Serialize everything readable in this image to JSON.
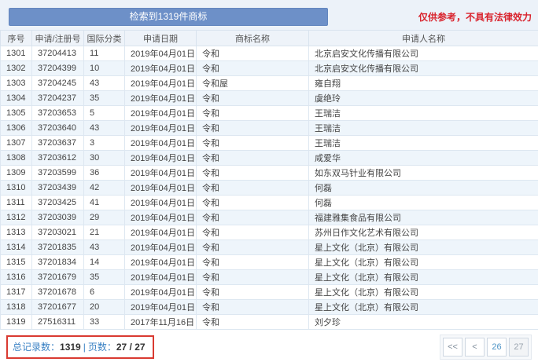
{
  "header": {
    "search_result_button": "检索到1319件商标",
    "disclaimer": "仅供参考，不具有法律效力"
  },
  "table": {
    "columns": [
      "序号",
      "申请/注册号",
      "国际分类",
      "申请日期",
      "商标名称",
      "申请人名称"
    ],
    "rows": [
      {
        "no": "1301",
        "reg_no": "37204413",
        "intl_class": "11",
        "date": "2019年04月01日",
        "mark": "令和",
        "applicant": "北京启安文化传播有限公司"
      },
      {
        "no": "1302",
        "reg_no": "37204399",
        "intl_class": "10",
        "date": "2019年04月01日",
        "mark": "令和",
        "applicant": "北京启安文化传播有限公司"
      },
      {
        "no": "1303",
        "reg_no": "37204245",
        "intl_class": "43",
        "date": "2019年04月01日",
        "mark": "令和屋",
        "applicant": "雍自翔"
      },
      {
        "no": "1304",
        "reg_no": "37204237",
        "intl_class": "35",
        "date": "2019年04月01日",
        "mark": "令和",
        "applicant": "虞绝玲"
      },
      {
        "no": "1305",
        "reg_no": "37203653",
        "intl_class": "5",
        "date": "2019年04月01日",
        "mark": "令和",
        "applicant": "王瑞洁"
      },
      {
        "no": "1306",
        "reg_no": "37203640",
        "intl_class": "43",
        "date": "2019年04月01日",
        "mark": "令和",
        "applicant": "王瑞洁"
      },
      {
        "no": "1307",
        "reg_no": "37203637",
        "intl_class": "3",
        "date": "2019年04月01日",
        "mark": "令和",
        "applicant": "王瑞洁"
      },
      {
        "no": "1308",
        "reg_no": "37203612",
        "intl_class": "30",
        "date": "2019年04月01日",
        "mark": "令和",
        "applicant": "咸爱华"
      },
      {
        "no": "1309",
        "reg_no": "37203599",
        "intl_class": "36",
        "date": "2019年04月01日",
        "mark": "令和",
        "applicant": "如东双马针业有限公司"
      },
      {
        "no": "1310",
        "reg_no": "37203439",
        "intl_class": "42",
        "date": "2019年04月01日",
        "mark": "令和",
        "applicant": "何磊"
      },
      {
        "no": "1311",
        "reg_no": "37203425",
        "intl_class": "41",
        "date": "2019年04月01日",
        "mark": "令和",
        "applicant": "何磊"
      },
      {
        "no": "1312",
        "reg_no": "37203039",
        "intl_class": "29",
        "date": "2019年04月01日",
        "mark": "令和",
        "applicant": "福建雅集食品有限公司"
      },
      {
        "no": "1313",
        "reg_no": "37203021",
        "intl_class": "21",
        "date": "2019年04月01日",
        "mark": "令和",
        "applicant": "苏州日作文化艺术有限公司"
      },
      {
        "no": "1314",
        "reg_no": "37201835",
        "intl_class": "43",
        "date": "2019年04月01日",
        "mark": "令和",
        "applicant": "星上文化（北京）有限公司"
      },
      {
        "no": "1315",
        "reg_no": "37201834",
        "intl_class": "14",
        "date": "2019年04月01日",
        "mark": "令和",
        "applicant": "星上文化（北京）有限公司"
      },
      {
        "no": "1316",
        "reg_no": "37201679",
        "intl_class": "35",
        "date": "2019年04月01日",
        "mark": "令和",
        "applicant": "星上文化（北京）有限公司"
      },
      {
        "no": "1317",
        "reg_no": "37201678",
        "intl_class": "6",
        "date": "2019年04月01日",
        "mark": "令和",
        "applicant": "星上文化（北京）有限公司"
      },
      {
        "no": "1318",
        "reg_no": "37201677",
        "intl_class": "20",
        "date": "2019年04月01日",
        "mark": "令和",
        "applicant": "星上文化（北京）有限公司"
      },
      {
        "no": "1319",
        "reg_no": "27516311",
        "intl_class": "33",
        "date": "2017年11月16日",
        "mark": "令和",
        "applicant": "刘夕珍"
      }
    ]
  },
  "footer": {
    "total_label": "总记录数：",
    "total_value": "1319",
    "separator": "|",
    "pages_label": "页数：",
    "pages_value": "27 / 27",
    "pagination": [
      {
        "label": "<<",
        "state": "nav"
      },
      {
        "label": "<",
        "state": "nav"
      },
      {
        "label": "26",
        "state": "link"
      },
      {
        "label": "27",
        "state": "current"
      }
    ]
  },
  "colors": {
    "button_blue": "#6d90c8",
    "link_blue": "#4e94c6",
    "alert_red": "#d9232d",
    "annotation_box_red": "#d93a31",
    "stripe_blue": "#eef5fb"
  }
}
